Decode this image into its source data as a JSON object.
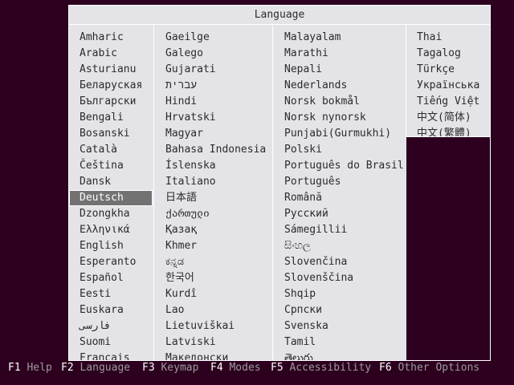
{
  "dialog": {
    "title": "Language",
    "selected": "Deutsch",
    "columns": [
      [
        "Amharic",
        "Arabic",
        "Asturianu",
        "Беларуская",
        "Български",
        "Bengali",
        "Bosanski",
        "Català",
        "Čeština",
        "Dansk",
        "Deutsch",
        "Dzongkha",
        "Ελληνικά",
        "English",
        "Esperanto",
        "Español",
        "Eesti",
        "Euskara",
        "فارسی",
        "Suomi",
        "Français"
      ],
      [
        "Gaeilge",
        "Galego",
        "Gujarati",
        "עברית",
        "Hindi",
        "Hrvatski",
        "Magyar",
        "Bahasa Indonesia",
        "Íslenska",
        "Italiano",
        "日本語",
        "ქართული",
        "Қазақ",
        "Khmer",
        "ಕನ್ನಡ",
        "한국어",
        "Kurdî",
        "Lao",
        "Lietuviškai",
        "Latviski",
        "Македонски"
      ],
      [
        "Malayalam",
        "Marathi",
        "Nepali",
        "Nederlands",
        "Norsk bokmål",
        "Norsk nynorsk",
        "Punjabi(Gurmukhi)",
        "Polski",
        "Português do Brasil",
        "Português",
        "Română",
        "Русский",
        "Sámegillii",
        "සිංහල",
        "Slovenčina",
        "Slovenščina",
        "Shqip",
        "Српски",
        "Svenska",
        "Tamil",
        "తెలుగు"
      ],
      [
        "Thai",
        "Tagalog",
        "Türkçe",
        "Українська",
        "Tiếng Việt",
        "中文(简体)",
        "中文(繁體)"
      ]
    ]
  },
  "fkeys": [
    {
      "key": "F1",
      "label": "Help"
    },
    {
      "key": "F2",
      "label": "Language"
    },
    {
      "key": "F3",
      "label": "Keymap"
    },
    {
      "key": "F4",
      "label": "Modes"
    },
    {
      "key": "F5",
      "label": "Accessibility"
    },
    {
      "key": "F6",
      "label": "Other Options"
    }
  ],
  "colors": {
    "background": "#2c001e",
    "dialog": "#e4e4e8",
    "selection": "#727272",
    "fkey_label": "#9f9a9d"
  }
}
